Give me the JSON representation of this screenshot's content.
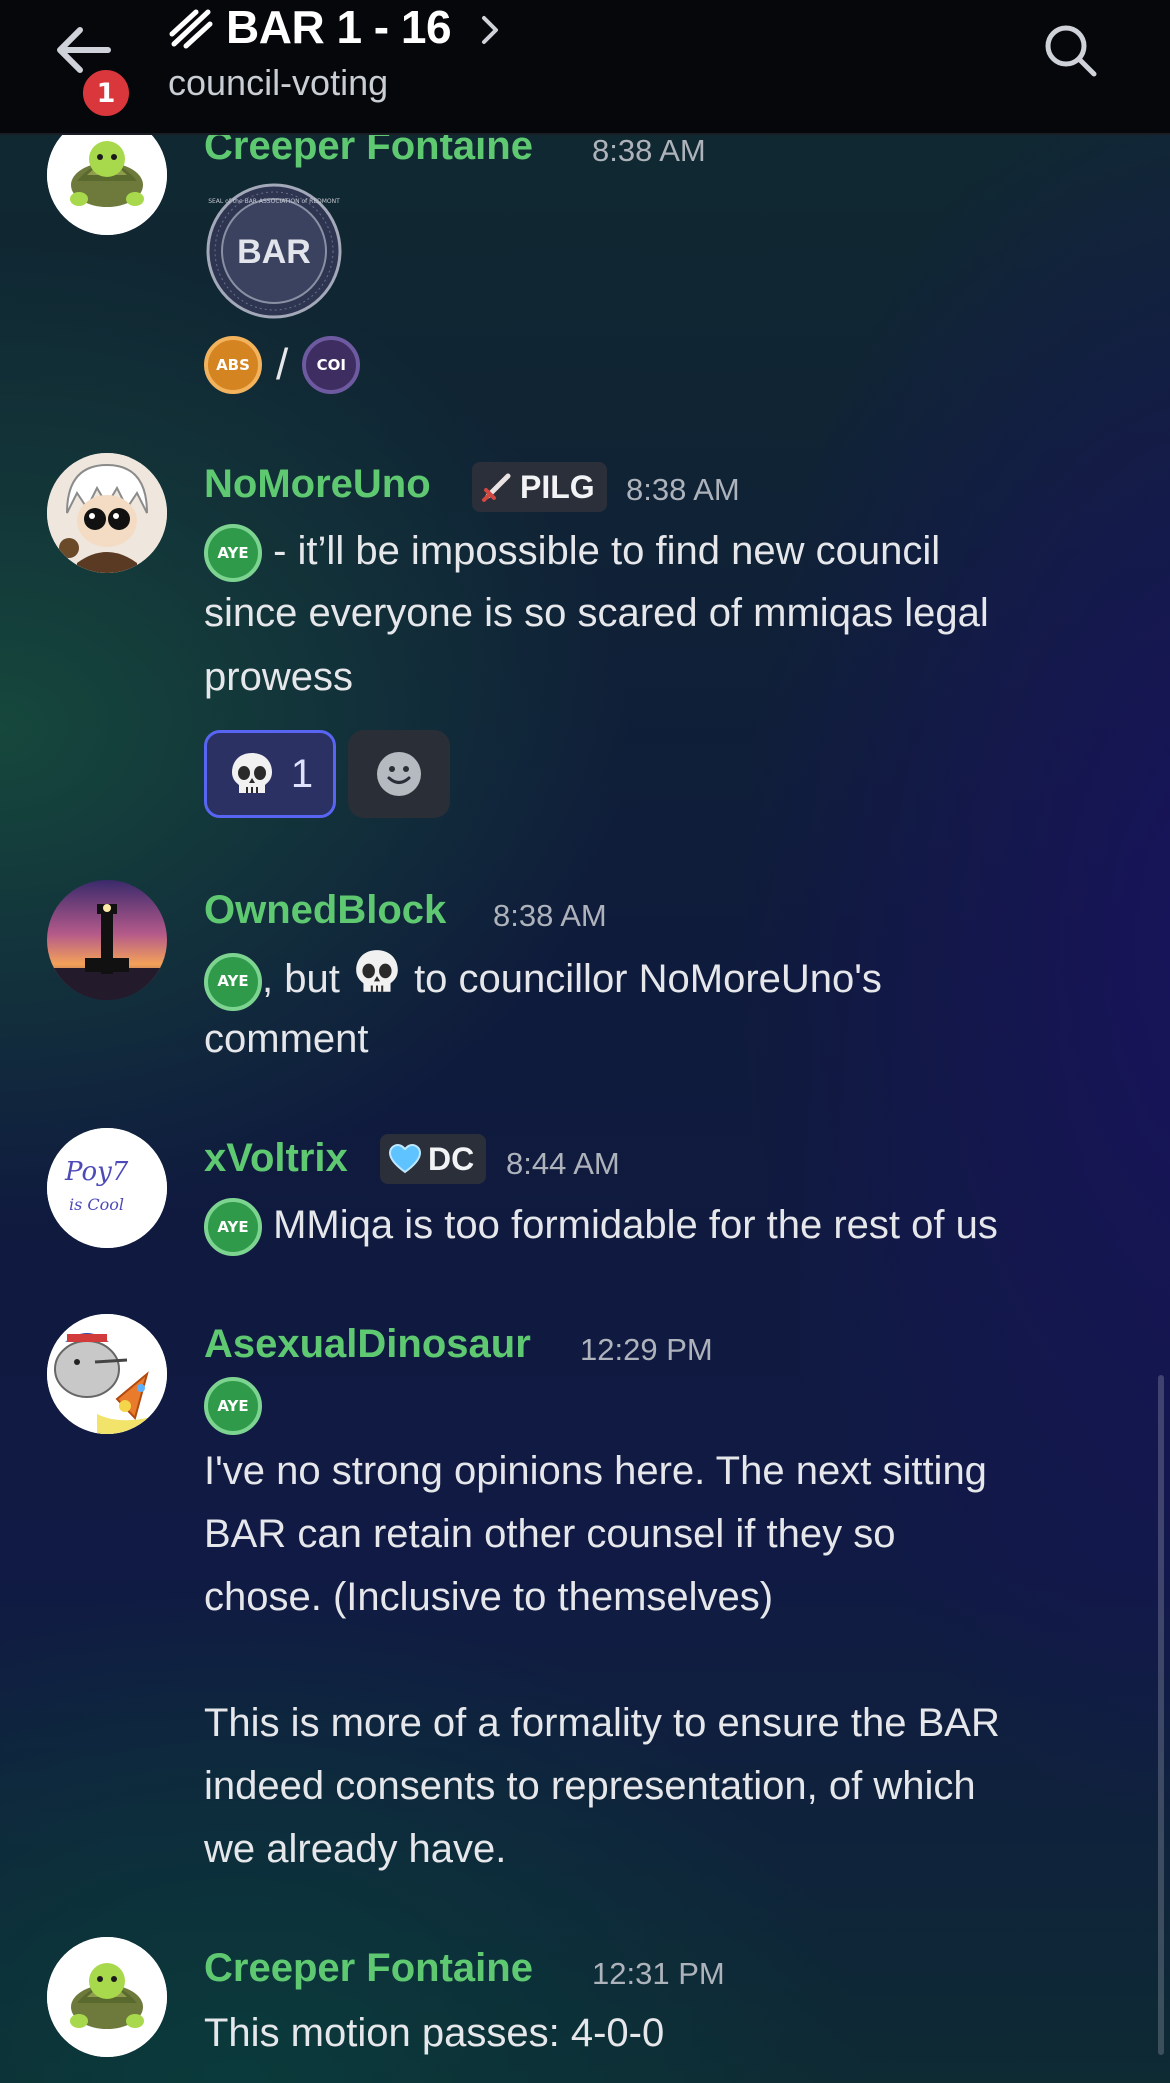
{
  "header": {
    "badge_count": "1",
    "channel_title": "BAR 1 - 16",
    "channel_subtitle": "council-voting"
  },
  "messages": [
    {
      "author": "Creeper Fontaine",
      "time": "8:38 AM",
      "seal_text": "BAR",
      "seal_ring_text": "SEAL of the BAR ASSOCIATION of REDMONT",
      "vote_abs": "ABS",
      "separator": "/",
      "vote_coi": "COI"
    },
    {
      "author": "NoMoreUno",
      "tag": "PILG",
      "time": "8:38 AM",
      "vote": "AYE",
      "line1": " - it’ll be impossible to find new council",
      "line2": "since everyone is so scared of mmiqas legal",
      "line3": "prowess",
      "reaction_count": "1"
    },
    {
      "author": "OwnedBlock",
      "time": "8:38 AM",
      "vote": "AYE",
      "line1a": ", but ",
      "line1b": " to councillor NoMoreUno's",
      "line2": "comment"
    },
    {
      "author": "xVoltrix",
      "tag": "DC",
      "time": "8:44 AM",
      "vote": "AYE",
      "line1": " MMiqa is too formidable for the rest of us",
      "avatar_text1": "Poy7",
      "avatar_text2": "is Cool"
    },
    {
      "author": "AsexualDinosaur",
      "time": "12:29 PM",
      "vote": "AYE",
      "para1_line1": "I've no strong opinions here. The next sitting",
      "para1_line2": "BAR can retain other counsel if they so",
      "para1_line3": "chose. (Inclusive to themselves)",
      "para2_line1": "This is more of a formality to ensure the BAR",
      "para2_line2": "indeed consents to representation, of which",
      "para2_line3": "we already have."
    },
    {
      "author": "Creeper Fontaine",
      "time": "12:31 PM",
      "line1": "This motion passes: 4-0-0"
    }
  ],
  "colors": {
    "username": "#5fc972",
    "header_bg": "#05070b",
    "badge": "#da373c",
    "aye": "#2f9b4a",
    "reaction_active_border": "#5865f2"
  }
}
